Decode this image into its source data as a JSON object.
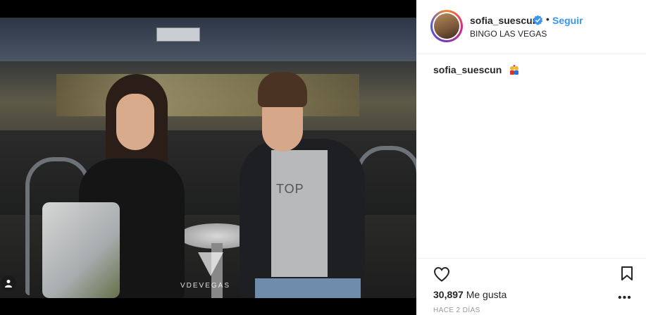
{
  "post": {
    "username": "sofia_suescun",
    "verified": true,
    "separator": "•",
    "follow_label": "Seguir",
    "location": "BINGO LAS VEGAS",
    "caption_user": "sofia_suescun",
    "caption_emoji": "couple-emoji",
    "likes_count": "30,897",
    "likes_label": "Me gusta",
    "time_ago": "HACE 2 DÍAS",
    "more_label": "•••"
  },
  "photo": {
    "watermark": "VDEVEGAS",
    "shirt_text": "TOP"
  },
  "icons": {
    "tag": "person-tag-icon",
    "verified": "verified-badge-icon",
    "like": "heart-icon",
    "save": "bookmark-icon",
    "more": "more-options-icon"
  },
  "colors": {
    "link": "#3897f0",
    "text": "#262626",
    "muted": "#999999",
    "border": "#efefef"
  }
}
